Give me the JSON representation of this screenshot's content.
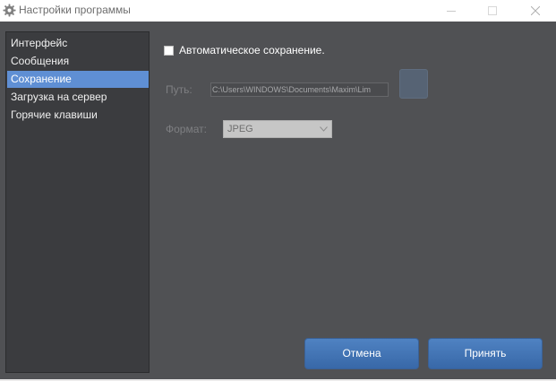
{
  "window": {
    "title": "Настройки программы",
    "app_icon": "gear-icon",
    "controls": [
      "minimize-icon",
      "maximize-icon",
      "close-icon"
    ]
  },
  "sidebar": {
    "items": [
      {
        "label": "Интерфейс",
        "selected": false
      },
      {
        "label": "Сообщения",
        "selected": false
      },
      {
        "label": "Сохранение",
        "selected": true
      },
      {
        "label": "Загрузка на сервер",
        "selected": false
      },
      {
        "label": "Горячие клавиши",
        "selected": false
      }
    ]
  },
  "save_settings": {
    "autosave_label": "Автоматическое сохранение.",
    "autosave_checked": false,
    "path_label": "Путь:",
    "path_value": "C:\\Users\\WINDOWS\\Documents\\Maxim\\Lim",
    "format_label": "Формат:",
    "format_value": "JPEG"
  },
  "footer": {
    "cancel_label": "Отмена",
    "apply_label": "Принять"
  },
  "colors": {
    "background": "#505154",
    "sidebar": "#3b3c3f",
    "selection": "#5f8fd4",
    "button": "#4577b7"
  }
}
